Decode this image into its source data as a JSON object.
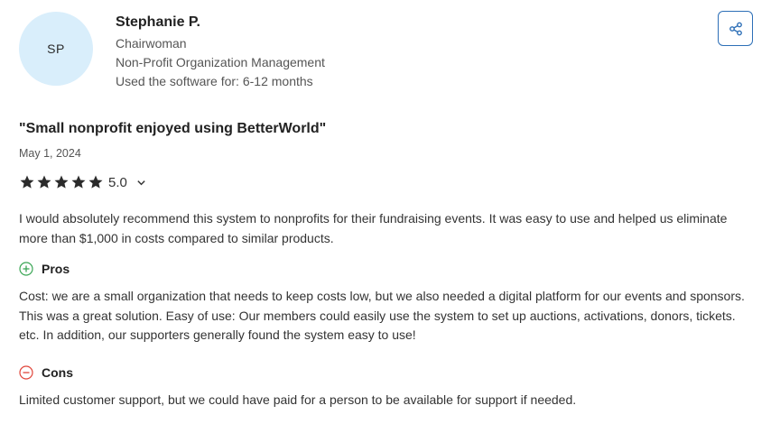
{
  "reviewer": {
    "initials": "SP",
    "name": "Stephanie P.",
    "role": "Chairwoman",
    "industry": "Non-Profit Organization Management",
    "usage": "Used the software for: 6-12 months"
  },
  "review": {
    "title": "\"Small nonprofit enjoyed using BetterWorld\"",
    "date": "May 1, 2024",
    "rating": "5.0",
    "stars": 5,
    "summary": "I would absolutely recommend this system to nonprofits for their fundraising events. It was easy to use and helped us eliminate more than $1,000 in costs compared to similar products.",
    "pros_label": "Pros",
    "pros": "Cost: we are a small organization that needs to keep costs low, but we also needed a digital platform for our events and sponsors. This was a great solution. Easy of use: Our members could easily use the system to set up auctions, activations, donors, tickets. etc. In addition, our supporters generally found the system easy to use!",
    "cons_label": "Cons",
    "cons": "Limited customer support, but we could have paid for a person to be available for support if needed."
  },
  "icons": {
    "share": "share-icon",
    "star": "star-icon",
    "chevron": "chevron-down-icon",
    "pros": "plus-circle-icon",
    "cons": "minus-circle-icon"
  },
  "colors": {
    "avatar_bg": "#d9eefb",
    "share_border": "#2d6fb7",
    "pros": "#3aa655",
    "cons": "#e0453a",
    "star": "#2b2b2b"
  }
}
